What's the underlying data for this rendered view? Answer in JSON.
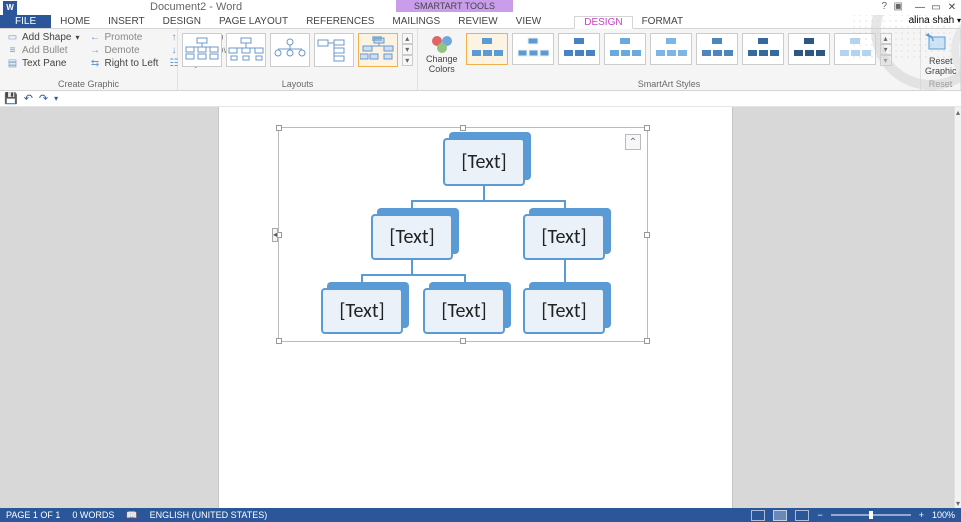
{
  "title": "Document2 - Word",
  "smartart_tools_label": "SMARTART TOOLS",
  "username": "alina shah",
  "help_icon": "?",
  "tabs": {
    "file": "FILE",
    "home": "HOME",
    "insert": "INSERT",
    "design": "DESIGN",
    "page_layout": "PAGE LAYOUT",
    "references": "REFERENCES",
    "mailings": "MAILINGS",
    "review": "REVIEW",
    "view": "VIEW",
    "sa_design": "DESIGN",
    "sa_format": "FORMAT"
  },
  "ribbon": {
    "create_graphic": {
      "label": "Create Graphic",
      "add_shape": "Add Shape",
      "add_bullet": "Add Bullet",
      "text_pane": "Text Pane",
      "promote": "Promote",
      "demote": "Demote",
      "right_to_left": "Right to Left",
      "move_up": "Move Up",
      "move_down": "Move Down",
      "layout": "Layout"
    },
    "layouts": {
      "label": "Layouts"
    },
    "change_colors": {
      "label": "Change\nColors"
    },
    "smartart_styles": {
      "label": "SmartArt Styles"
    },
    "reset": {
      "label": "Reset",
      "button": "Reset\nGraphic"
    }
  },
  "smartart": {
    "nodes": {
      "root": "[Text]",
      "c1": "[Text]",
      "c2": "[Text]",
      "g1": "[Text]",
      "g2": "[Text]",
      "g3": "[Text]"
    }
  },
  "status": {
    "page": "PAGE 1 OF 1",
    "words": "0 WORDS",
    "language": "ENGLISH (UNITED STATES)",
    "zoom": "100%"
  }
}
